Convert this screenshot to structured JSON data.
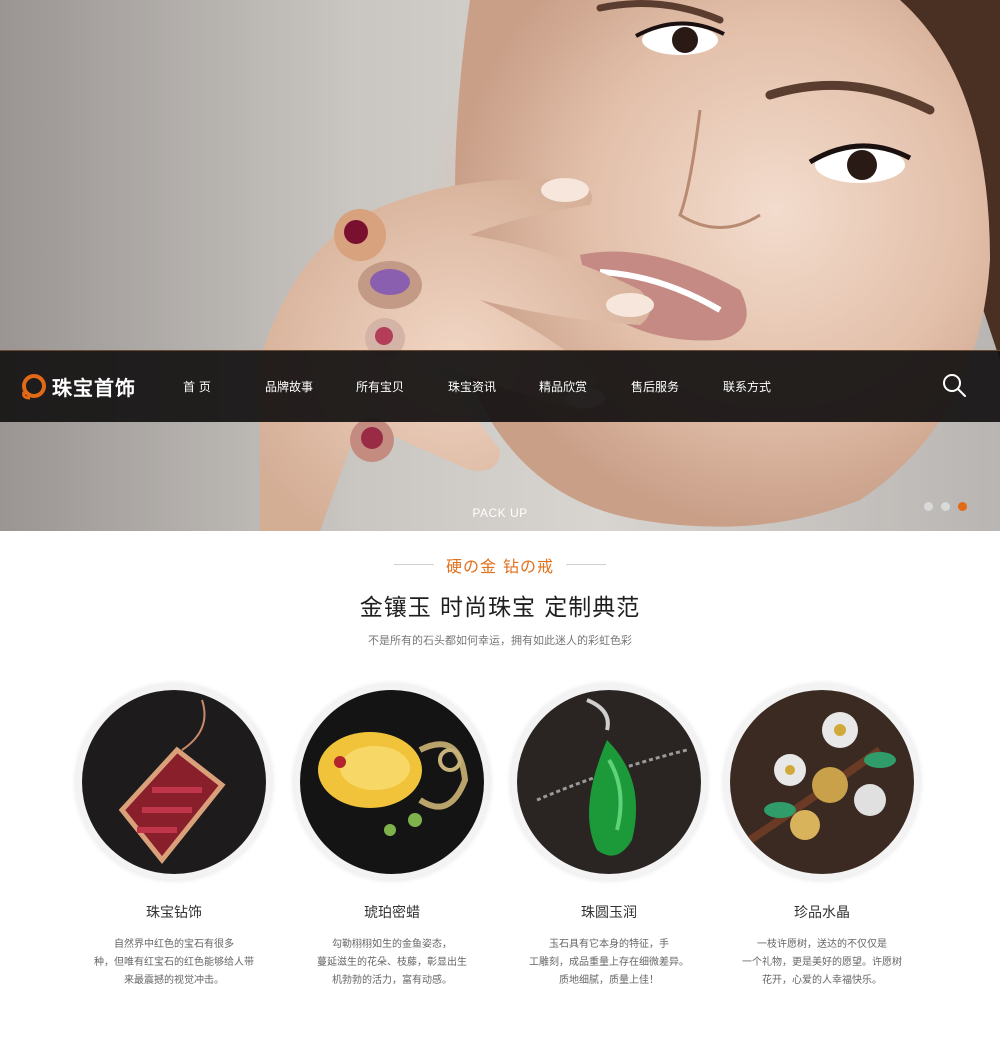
{
  "hero": {
    "caption": "PACK UP",
    "slides": 3,
    "active_slide": 3,
    "accent": "#e26a17"
  },
  "nav": {
    "logo_text": "珠宝首饰",
    "items": [
      "首 页",
      "品牌故事",
      "所有宝贝",
      "珠宝资讯",
      "精品欣赏",
      "售后服务",
      "联系方式"
    ],
    "search_icon": "search-icon"
  },
  "intro": {
    "eyebrow": "硬の金 钻の戒",
    "headline": "金镶玉 时尚珠宝 定制典范",
    "subline": "不是所有的石头都如何幸运，拥有如此迷人的彩虹色彩"
  },
  "products": [
    {
      "title": "珠宝钻饰",
      "desc": [
        "自然界中红色的宝石有很多",
        "种，但唯有红宝石的红色能够给人带",
        "来最震撼的视觉冲击。"
      ]
    },
    {
      "title": "琥珀密蜡",
      "desc": [
        "勾勒栩栩如生的金鱼姿态，",
        "蔓延滋生的花朵、枝藤，彰显出生",
        "机勃勃的活力，富有动感。"
      ]
    },
    {
      "title": "珠圆玉润",
      "desc": [
        "玉石具有它本身的特征，手",
        "工雕刻，成品重量上存在细微差异。",
        "质地细腻，质量上佳！"
      ]
    },
    {
      "title": "珍品水晶",
      "desc": [
        "一枝许愿树，送达的不仅仅是",
        "一个礼物，更是美好的愿望。许愿树",
        "花开，心爱的人幸福快乐。"
      ]
    }
  ],
  "colors": {
    "accent": "#e0711d",
    "nav_bg": "#141212"
  }
}
